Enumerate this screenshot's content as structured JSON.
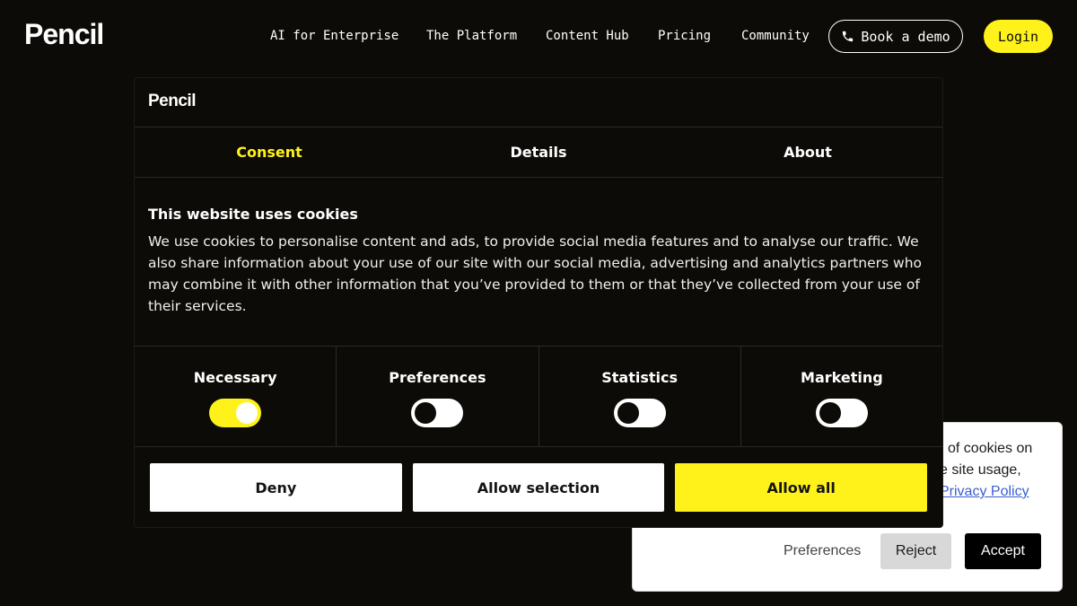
{
  "header": {
    "logo": "Pencil",
    "nav": [
      {
        "label": "AI for Enterprise"
      },
      {
        "label": "The Platform"
      },
      {
        "label": "Content Hub"
      },
      {
        "label": "Pricing"
      },
      {
        "label": "Community"
      }
    ],
    "demo_label": "Book a demo",
    "login_label": "Login"
  },
  "background_card": {
    "line1": "of cookies on",
    "line2": "ze site usage,",
    "link": "Privacy Policy",
    "preferences": "Preferences",
    "reject": "Reject",
    "accept": "Accept"
  },
  "dialog": {
    "logo": "Pencil",
    "tabs": [
      {
        "label": "Consent",
        "active": true
      },
      {
        "label": "Details",
        "active": false
      },
      {
        "label": "About",
        "active": false
      }
    ],
    "title": "This website uses cookies",
    "body": "We use cookies to personalise content and ads, to provide social media features and to analyse our traffic. We also share information about your use of our site with our social media, advertising and analytics partners who may combine it with other information that you’ve provided to them or that they’ve collected from your use of their services.",
    "toggles": [
      {
        "label": "Necessary",
        "on": true
      },
      {
        "label": "Preferences",
        "on": false
      },
      {
        "label": "Statistics",
        "on": false
      },
      {
        "label": "Marketing",
        "on": false
      }
    ],
    "buttons": {
      "deny": "Deny",
      "allow_selection": "Allow selection",
      "allow_all": "Allow all"
    }
  },
  "colors": {
    "background": "#0c0b07",
    "accent": "#fff21a",
    "text": "#ffffff"
  }
}
